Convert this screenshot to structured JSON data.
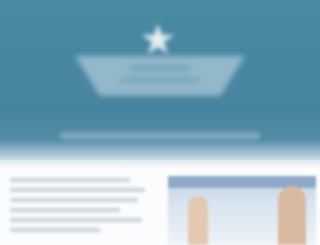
{
  "hero": {
    "background": "#4784a0",
    "logo_icon": "star-icon",
    "logo_shape": "boat-logo"
  },
  "content": {
    "text_lines": 6,
    "photo": "people-photo"
  }
}
